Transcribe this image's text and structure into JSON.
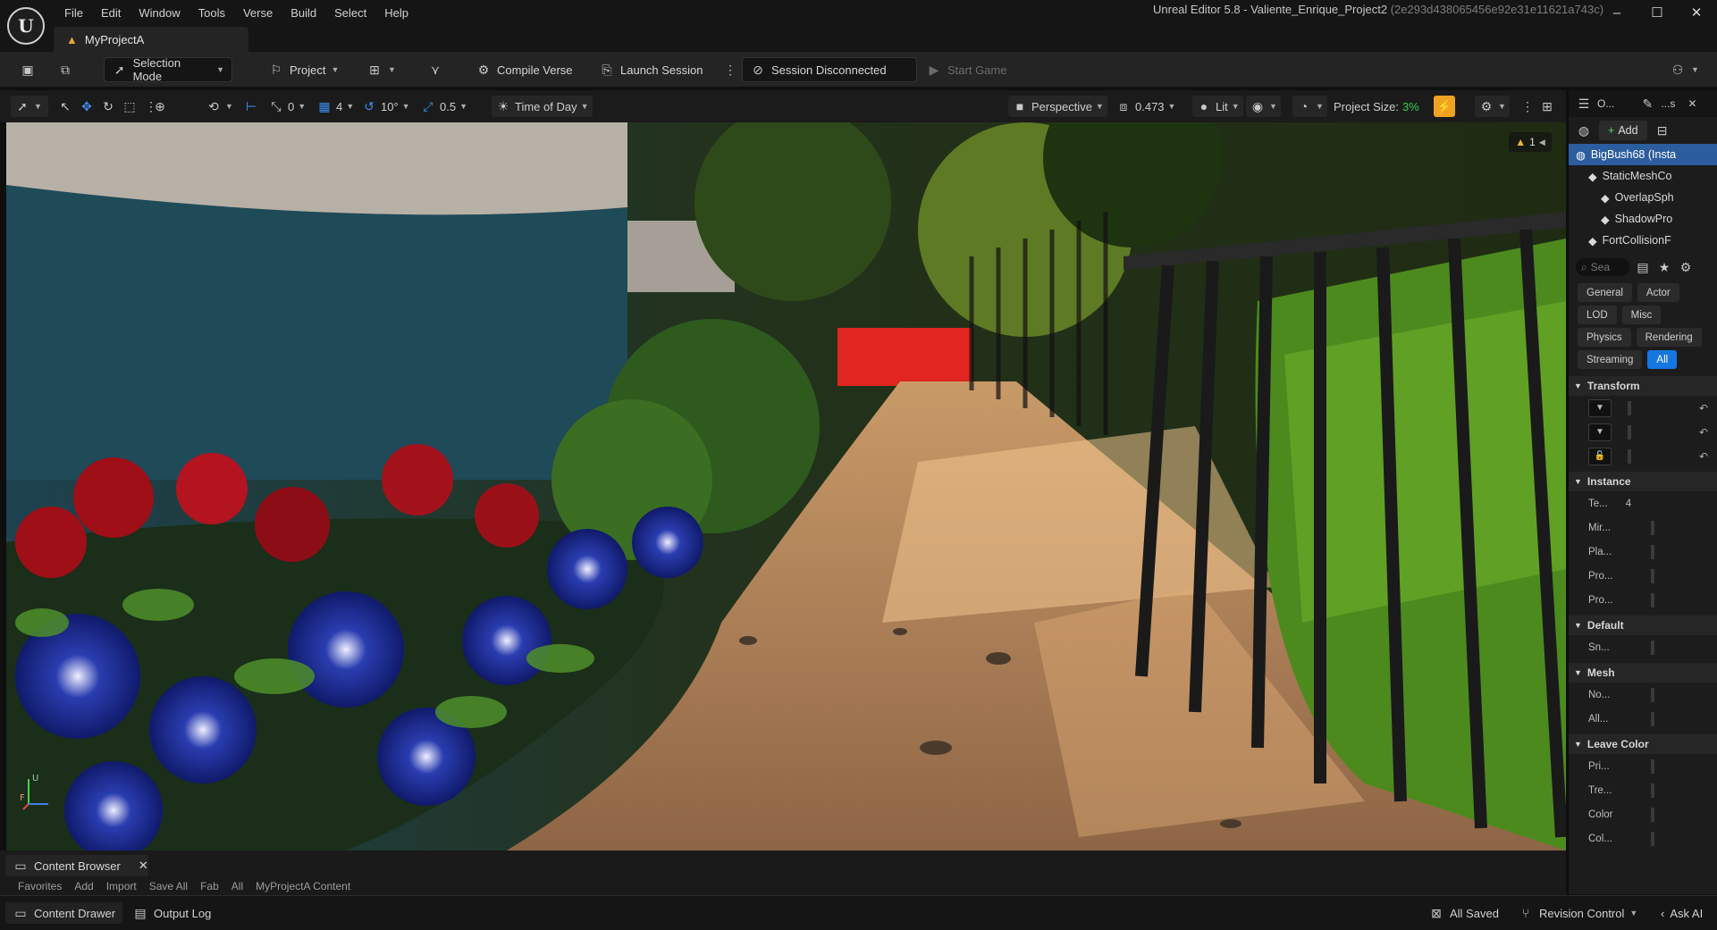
{
  "app": {
    "logo_text": "U",
    "window_title": "Unreal Editor 5.8 - Valiente_Enrique_Project2",
    "window_hash": "(2e293d438065456e92e31e11621a743c)",
    "project_tab": "MyProjectA"
  },
  "menu": [
    "File",
    "Edit",
    "Window",
    "Tools",
    "Verse",
    "Build",
    "Select",
    "Help"
  ],
  "window_controls": {
    "minimize": "–",
    "maximize": "☐",
    "close": "✕"
  },
  "toolbar": {
    "selection_mode": "Selection Mode",
    "project": "Project",
    "compile_verse": "Compile Verse",
    "launch_session": "Launch Session",
    "session_status": "Session Disconnected",
    "start_game": "Start Game"
  },
  "viewport_toolbar": {
    "rotate_snap": "0",
    "grid_snap": "4",
    "angle_snap": "10°",
    "scale_snap": "0.5",
    "time_of_day": "Time of Day",
    "perspective": "Perspective",
    "camera_speed": "0.473",
    "lit": "Lit",
    "project_size_label": "Project Size:",
    "project_size_value": "3%",
    "warnings_count": "1"
  },
  "viewport": {
    "axis_up": "U",
    "axis_forward": "F"
  },
  "right_panel": {
    "tab_outliner": "O...",
    "tab_details": "...s",
    "add_button": "Add",
    "outliner_items": [
      {
        "label": "BigBush68 (Insta",
        "selected": true,
        "indent": 0
      },
      {
        "label": "StaticMeshCo",
        "selected": false,
        "indent": 1
      },
      {
        "label": "OverlapSph",
        "selected": false,
        "indent": 2
      },
      {
        "label": "ShadowPro",
        "selected": false,
        "indent": 2
      },
      {
        "label": "FortCollisionF",
        "selected": false,
        "indent": 1
      }
    ],
    "search_placeholder": "Sea",
    "filter_chips": [
      "General",
      "Actor",
      "LOD",
      "Misc",
      "Physics",
      "Rendering",
      "Streaming",
      "All"
    ],
    "active_chip": "All",
    "sections": [
      {
        "title": "Transform",
        "props": [
          "",
          "",
          ""
        ]
      },
      {
        "title": "Instance",
        "props": [
          "Te...",
          "Mir...",
          "Pla...",
          "Pro...",
          "Pro..."
        ]
      },
      {
        "title": "Default",
        "props": [
          "Sn..."
        ]
      },
      {
        "title": "Mesh",
        "props": [
          "No...",
          "All..."
        ]
      },
      {
        "title": "Leave Color",
        "props": [
          "Pri...",
          "Tre...",
          "Color",
          "Col..."
        ]
      }
    ],
    "instance_value": "4"
  },
  "content_browser": {
    "tab_label": "Content Browser",
    "sub_items": [
      "Favorites",
      "Add",
      "Import",
      "Save All",
      "Fab",
      "All",
      "MyProjectA Content"
    ]
  },
  "statusbar": {
    "content_drawer": "Content Drawer",
    "output_log": "Output Log",
    "all_saved": "All Saved",
    "revision_control": "Revision Control",
    "ask_ai": "Ask AI"
  },
  "colors": {
    "accent_blue": "#1576df",
    "selection_blue": "#2c5d9e",
    "project_size_green": "#32d04e",
    "snap_orange": "#f0a322",
    "warning_yellow": "#f2b733"
  }
}
